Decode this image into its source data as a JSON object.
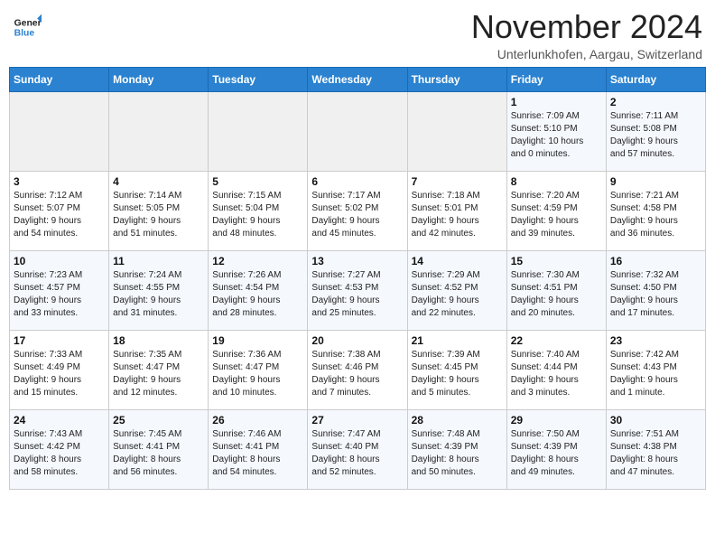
{
  "header": {
    "logo_line1": "General",
    "logo_line2": "Blue",
    "month": "November 2024",
    "location": "Unterlunkhofen, Aargau, Switzerland"
  },
  "weekdays": [
    "Sunday",
    "Monday",
    "Tuesday",
    "Wednesday",
    "Thursday",
    "Friday",
    "Saturday"
  ],
  "weeks": [
    [
      {
        "day": "",
        "info": ""
      },
      {
        "day": "",
        "info": ""
      },
      {
        "day": "",
        "info": ""
      },
      {
        "day": "",
        "info": ""
      },
      {
        "day": "",
        "info": ""
      },
      {
        "day": "1",
        "info": "Sunrise: 7:09 AM\nSunset: 5:10 PM\nDaylight: 10 hours\nand 0 minutes."
      },
      {
        "day": "2",
        "info": "Sunrise: 7:11 AM\nSunset: 5:08 PM\nDaylight: 9 hours\nand 57 minutes."
      }
    ],
    [
      {
        "day": "3",
        "info": "Sunrise: 7:12 AM\nSunset: 5:07 PM\nDaylight: 9 hours\nand 54 minutes."
      },
      {
        "day": "4",
        "info": "Sunrise: 7:14 AM\nSunset: 5:05 PM\nDaylight: 9 hours\nand 51 minutes."
      },
      {
        "day": "5",
        "info": "Sunrise: 7:15 AM\nSunset: 5:04 PM\nDaylight: 9 hours\nand 48 minutes."
      },
      {
        "day": "6",
        "info": "Sunrise: 7:17 AM\nSunset: 5:02 PM\nDaylight: 9 hours\nand 45 minutes."
      },
      {
        "day": "7",
        "info": "Sunrise: 7:18 AM\nSunset: 5:01 PM\nDaylight: 9 hours\nand 42 minutes."
      },
      {
        "day": "8",
        "info": "Sunrise: 7:20 AM\nSunset: 4:59 PM\nDaylight: 9 hours\nand 39 minutes."
      },
      {
        "day": "9",
        "info": "Sunrise: 7:21 AM\nSunset: 4:58 PM\nDaylight: 9 hours\nand 36 minutes."
      }
    ],
    [
      {
        "day": "10",
        "info": "Sunrise: 7:23 AM\nSunset: 4:57 PM\nDaylight: 9 hours\nand 33 minutes."
      },
      {
        "day": "11",
        "info": "Sunrise: 7:24 AM\nSunset: 4:55 PM\nDaylight: 9 hours\nand 31 minutes."
      },
      {
        "day": "12",
        "info": "Sunrise: 7:26 AM\nSunset: 4:54 PM\nDaylight: 9 hours\nand 28 minutes."
      },
      {
        "day": "13",
        "info": "Sunrise: 7:27 AM\nSunset: 4:53 PM\nDaylight: 9 hours\nand 25 minutes."
      },
      {
        "day": "14",
        "info": "Sunrise: 7:29 AM\nSunset: 4:52 PM\nDaylight: 9 hours\nand 22 minutes."
      },
      {
        "day": "15",
        "info": "Sunrise: 7:30 AM\nSunset: 4:51 PM\nDaylight: 9 hours\nand 20 minutes."
      },
      {
        "day": "16",
        "info": "Sunrise: 7:32 AM\nSunset: 4:50 PM\nDaylight: 9 hours\nand 17 minutes."
      }
    ],
    [
      {
        "day": "17",
        "info": "Sunrise: 7:33 AM\nSunset: 4:49 PM\nDaylight: 9 hours\nand 15 minutes."
      },
      {
        "day": "18",
        "info": "Sunrise: 7:35 AM\nSunset: 4:47 PM\nDaylight: 9 hours\nand 12 minutes."
      },
      {
        "day": "19",
        "info": "Sunrise: 7:36 AM\nSunset: 4:47 PM\nDaylight: 9 hours\nand 10 minutes."
      },
      {
        "day": "20",
        "info": "Sunrise: 7:38 AM\nSunset: 4:46 PM\nDaylight: 9 hours\nand 7 minutes."
      },
      {
        "day": "21",
        "info": "Sunrise: 7:39 AM\nSunset: 4:45 PM\nDaylight: 9 hours\nand 5 minutes."
      },
      {
        "day": "22",
        "info": "Sunrise: 7:40 AM\nSunset: 4:44 PM\nDaylight: 9 hours\nand 3 minutes."
      },
      {
        "day": "23",
        "info": "Sunrise: 7:42 AM\nSunset: 4:43 PM\nDaylight: 9 hours\nand 1 minute."
      }
    ],
    [
      {
        "day": "24",
        "info": "Sunrise: 7:43 AM\nSunset: 4:42 PM\nDaylight: 8 hours\nand 58 minutes."
      },
      {
        "day": "25",
        "info": "Sunrise: 7:45 AM\nSunset: 4:41 PM\nDaylight: 8 hours\nand 56 minutes."
      },
      {
        "day": "26",
        "info": "Sunrise: 7:46 AM\nSunset: 4:41 PM\nDaylight: 8 hours\nand 54 minutes."
      },
      {
        "day": "27",
        "info": "Sunrise: 7:47 AM\nSunset: 4:40 PM\nDaylight: 8 hours\nand 52 minutes."
      },
      {
        "day": "28",
        "info": "Sunrise: 7:48 AM\nSunset: 4:39 PM\nDaylight: 8 hours\nand 50 minutes."
      },
      {
        "day": "29",
        "info": "Sunrise: 7:50 AM\nSunset: 4:39 PM\nDaylight: 8 hours\nand 49 minutes."
      },
      {
        "day": "30",
        "info": "Sunrise: 7:51 AM\nSunset: 4:38 PM\nDaylight: 8 hours\nand 47 minutes."
      }
    ]
  ]
}
